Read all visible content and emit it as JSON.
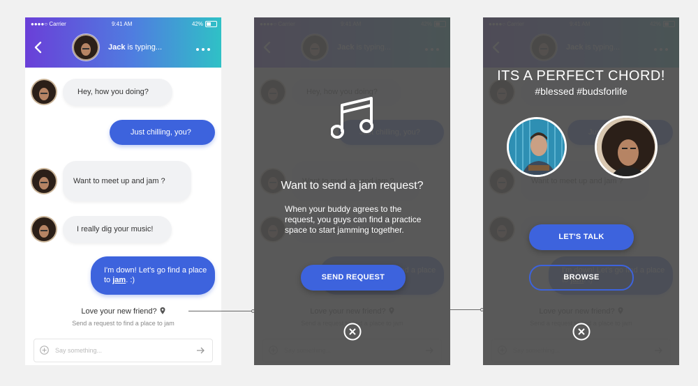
{
  "status": {
    "carrier": "●●●●○ Carrier",
    "time": "9:41 AM",
    "battery": "42%"
  },
  "header": {
    "name": "Jack",
    "typing": " is typing..."
  },
  "messages": [
    {
      "text": "Hey, how you doing?",
      "from": "them"
    },
    {
      "text": "Just chilling, you?",
      "from": "me"
    },
    {
      "text": "Want to meet up and jam ?",
      "from": "them"
    },
    {
      "text": "I really dig your music!",
      "from": "them"
    },
    {
      "text": "I'm down! Let's go find a place to ",
      "link": "jam",
      "tail": ". :)",
      "from": "me"
    }
  ],
  "love": {
    "title": "Love your new friend?",
    "hint": "Send a request to find a place to jam"
  },
  "input": {
    "placeholder": "Say something..."
  },
  "modal": {
    "title": "Want to send a jam request?",
    "body": "When your buddy agrees to the request, you guys can find a practice space to start jamming together.",
    "button": "SEND REQUEST"
  },
  "match": {
    "title": "ITS A PERFECT CHORD!",
    "tags": "#blessed #budsforlife",
    "talk_button": "LET'S TALK",
    "browse_button": "BROWSE"
  },
  "colors": {
    "accent": "#3d63dd",
    "gradient_start": "#6a3fd8",
    "gradient_end": "#2fc1c6",
    "overlay": "#4c4c4c"
  },
  "icons": [
    "back-icon",
    "more-icon",
    "location-pin-icon",
    "plus-circle-icon",
    "send-arrow-icon",
    "music-note-icon",
    "close-circle-icon"
  ]
}
